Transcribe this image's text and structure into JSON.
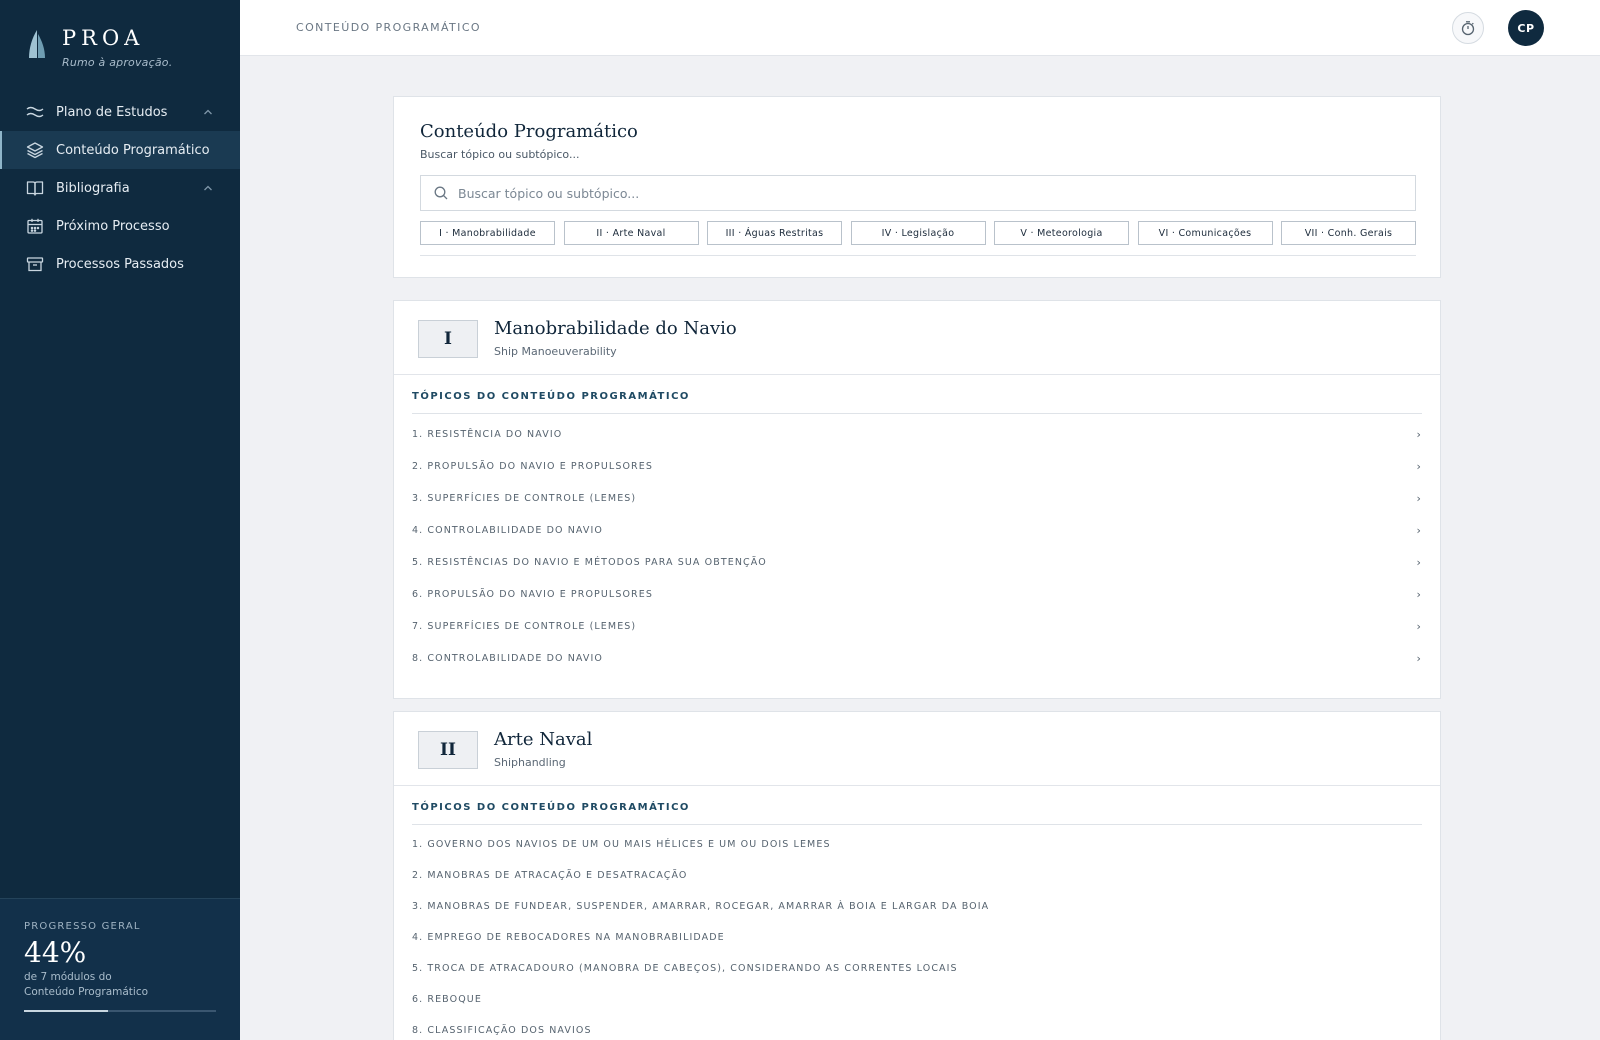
{
  "brand": {
    "name": "PROA",
    "tagline": "Rumo à aprovação."
  },
  "sidebar": {
    "items": [
      {
        "label": "Plano de Estudos",
        "icon": "waves-icon",
        "has_chevron": true,
        "active": false
      },
      {
        "label": "Conteúdo Programático",
        "icon": "layers-icon",
        "has_chevron": false,
        "active": true
      },
      {
        "label": "Bibliografia",
        "icon": "book-icon",
        "has_chevron": true,
        "active": false
      },
      {
        "label": "Próximo Processo",
        "icon": "calendar-icon",
        "has_chevron": false,
        "active": false
      },
      {
        "label": "Processos Passados",
        "icon": "archive-icon",
        "has_chevron": false,
        "active": false
      }
    ],
    "progress": {
      "label": "PROGRESSO GERAL",
      "value_text": "44%",
      "fraction": 0.44,
      "line1": "de 7 módulos do",
      "line2": "Conteúdo Programático"
    }
  },
  "topbar": {
    "title": "CONTEÚDO PROGRAMÁTICO",
    "timer_icon": "stopwatch-icon",
    "avatar_initials": "CP"
  },
  "search": {
    "title": "Conteúdo Programático",
    "subtitle": "Buscar tópico ou subtópico...",
    "placeholder": "Buscar tópico ou subtópico...",
    "chips": [
      "I · Manobrabilidade",
      "II · Arte Naval",
      "III · Águas Restritas",
      "IV · Legislação",
      "V · Meteorologia",
      "VI · Comunicações",
      "VII · Conh. Gerais"
    ]
  },
  "modules": [
    {
      "numeral": "I",
      "title": "Manobrabilidade do Navio",
      "subtitle": "Ship Manoeuverability",
      "topics_label": "TÓPICOS DO CONTEÚDO PROGRAMÁTICO",
      "topics": [
        "1. RESISTÊNCIA DO NAVIO",
        "2. PROPULSÃO DO NAVIO E PROPULSORES",
        "3. SUPERFÍCIES DE CONTROLE (LEMES)",
        "4. CONTROLABILIDADE DO NAVIO",
        "5. RESISTÊNCIAS DO NAVIO E MÉTODOS PARA SUA OBTENÇÃO",
        "6. PROPULSÃO DO NAVIO E PROPULSORES",
        "7. SUPERFÍCIES DE CONTROLE (LEMES)",
        "8. CONTROLABILIDADE DO NAVIO"
      ],
      "chevron": "›"
    },
    {
      "numeral": "II",
      "title": "Arte Naval",
      "subtitle": "Shiphandling",
      "topics_label": "TÓPICOS DO CONTEÚDO PROGRAMÁTICO",
      "topics": [
        "1. GOVERNO DOS NAVIOS DE UM OU MAIS HÉLICES E UM OU DOIS LEMES",
        "2. MANOBRAS DE ATRACAÇÃO E DESATRACAÇÃO",
        "3. MANOBRAS DE FUNDEAR, SUSPENDER, AMARRAR, ROCEGAR, AMARRAR À BOIA E LARGAR DA BOIA",
        "4. EMPREGO DE REBOCADORES NA MANOBRABILIDADE",
        "5. TROCA DE ATRACADOURO (MANOBRA DE CABEÇOS), CONSIDERANDO AS CORRENTES LOCAIS",
        "6. REBOQUE",
        "8. CLASSIFICAÇÃO DOS NAVIOS"
      ]
    }
  ],
  "colors": {
    "sidebar_bg": "#0f2a3f",
    "active_item_bg": "#1a3a52",
    "page_bg": "#f0f1f4",
    "accent_label": "#1f4a63"
  }
}
